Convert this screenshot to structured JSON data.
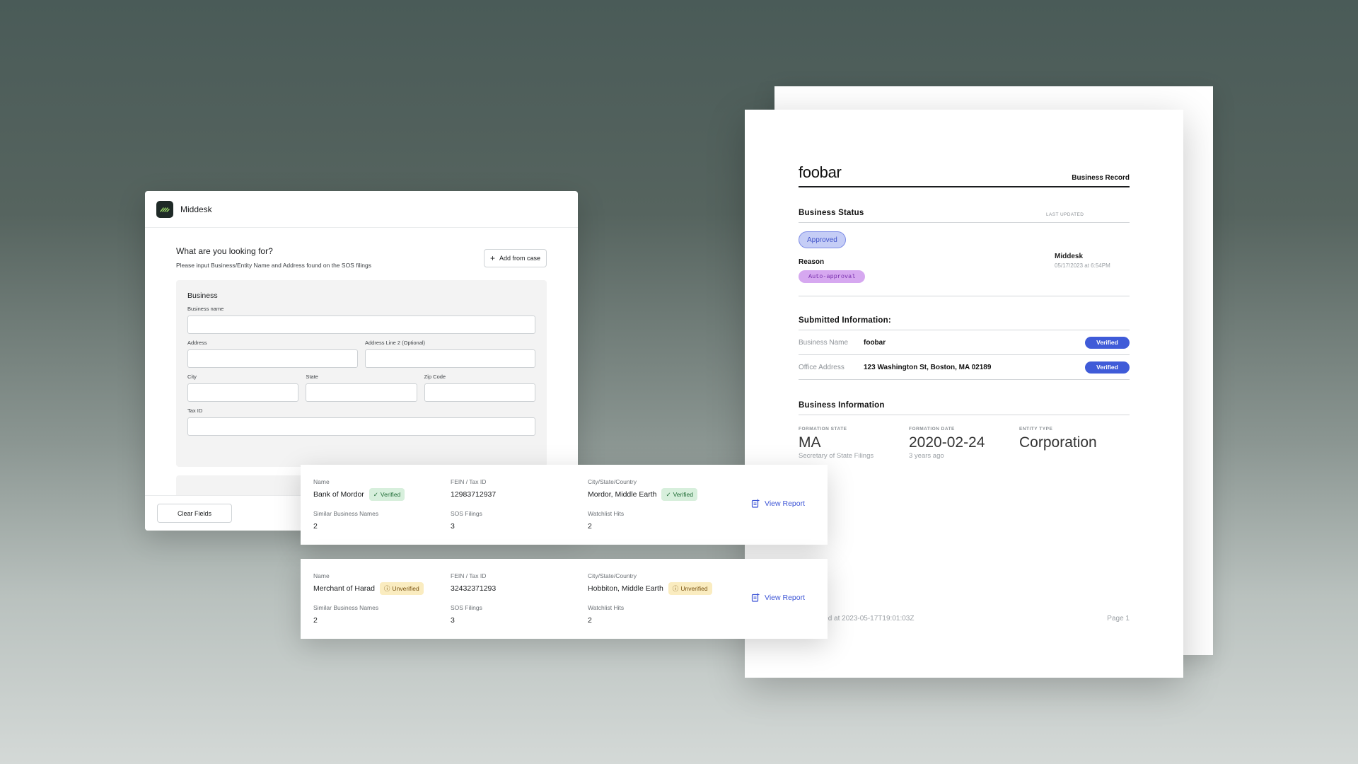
{
  "form": {
    "brand": "Middesk",
    "question": "What are you looking for?",
    "subtitle": "Please input Business/Entity Name and Address found on the SOS filings",
    "add_button": "Add from case",
    "panel_title": "Business",
    "labels": {
      "business_name": "Business name",
      "address": "Address",
      "address2": "Address Line 2 (Optional)",
      "city": "City",
      "state": "State",
      "zip": "Zip Code",
      "tax_id": "Tax ID"
    },
    "clear_button": "Clear Fields"
  },
  "report": {
    "title": "foobar",
    "doc_type": "Business Record",
    "status_section": {
      "title": "Business Status",
      "last_updated_label": "LAST UPDATED",
      "status": "Approved",
      "reason_label": "Reason",
      "reason": "Auto-approval",
      "updated_by": "Middesk",
      "updated_at": "05/17/2023 at 6:54PM"
    },
    "submitted_section": {
      "title": "Submitted Information:",
      "rows": [
        {
          "key": "Business Name",
          "value": "foobar",
          "status": "Verified"
        },
        {
          "key": "Office Address",
          "value": "123 Washington St, Boston, MA 02189",
          "status": "Verified"
        }
      ]
    },
    "info_section": {
      "title": "Business Information",
      "formation_state_label": "FORMATION STATE",
      "formation_state": "MA",
      "formation_state_sub": "Secretary of State Filings",
      "formation_date_label": "FORMATION DATE",
      "formation_date": "2020-02-24",
      "formation_date_sub": "3 years ago",
      "entity_type_label": "ENTITY TYPE",
      "entity_type": "Corporation"
    },
    "footer_left": "Generated at 2023-05-17T19:01:03Z",
    "footer_right": "Page 1"
  },
  "results": [
    {
      "name_label": "Name",
      "name": "Bank of Mordor",
      "name_status": "Verified",
      "fein_label": "FEIN / Tax ID",
      "fein": "12983712937",
      "location_label": "City/State/Country",
      "location": "Mordor, Middle Earth",
      "location_status": "Verified",
      "similar_label": "Similar Business Names",
      "similar": "2",
      "sos_label": "SOS Filings",
      "sos": "3",
      "watchlist_label": "Watchlist Hits",
      "watchlist": "2",
      "action": "View Report"
    },
    {
      "name_label": "Name",
      "name": "Merchant of Harad",
      "name_status": "Unverified",
      "fein_label": "FEIN / Tax ID",
      "fein": "32432371293",
      "location_label": "City/State/Country",
      "location": "Hobbiton, Middle Earth",
      "location_status": "Unverified",
      "similar_label": "Similar Business Names",
      "similar": "2",
      "sos_label": "SOS Filings",
      "sos": "3",
      "watchlist_label": "Watchlist Hits",
      "watchlist": "2",
      "action": "View Report"
    }
  ],
  "colors": {
    "accent": "#3d55d6",
    "verified_pill": "#3f5bd8",
    "approved_bg": "#c5cdf6",
    "auto_approval_bg": "#d6a8f0",
    "verified_badge_bg": "#d7efdc",
    "unverified_badge_bg": "#faecc0"
  },
  "icons": [
    "middesk-logo-icon",
    "plus-icon",
    "check-icon",
    "info-circle-icon",
    "report-icon"
  ]
}
